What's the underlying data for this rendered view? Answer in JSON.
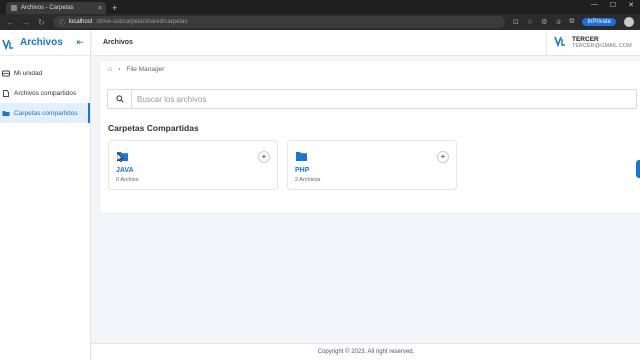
{
  "browser": {
    "tab_title": "Archivos - Carpetas",
    "new_tab": "+",
    "url_host": "localhost",
    "url_path": "/drive-subcarpeta/shared/carpetas",
    "inprivate_label": "InPrivate"
  },
  "sidebar": {
    "brand_title": "Archivos",
    "items": [
      {
        "label": "Mi unidad",
        "icon": "drive-icon"
      },
      {
        "label": "Archivos compartidos",
        "icon": "file-icon"
      },
      {
        "label": "Carpetas compartidos",
        "icon": "folder-open-icon",
        "active": true
      }
    ]
  },
  "header": {
    "title": "Archivos",
    "user_name": "TERCER",
    "user_email": "TERCER@GMAIL.COM"
  },
  "main": {
    "breadcrumb": "File Manager",
    "search_placeholder": "Buscar los archivos",
    "section_title": "Carpetas Compartidas",
    "folders": [
      {
        "name": "JAVA",
        "count": "0 Archivo"
      },
      {
        "name": "PHP",
        "count": "2 Archivos"
      }
    ]
  },
  "footer": {
    "text": "Copyright © 2023. All right reserved."
  },
  "colors": {
    "accent": "#1976d2",
    "active_bg": "#e3f0fc",
    "page_bg": "#f4f5fb"
  }
}
